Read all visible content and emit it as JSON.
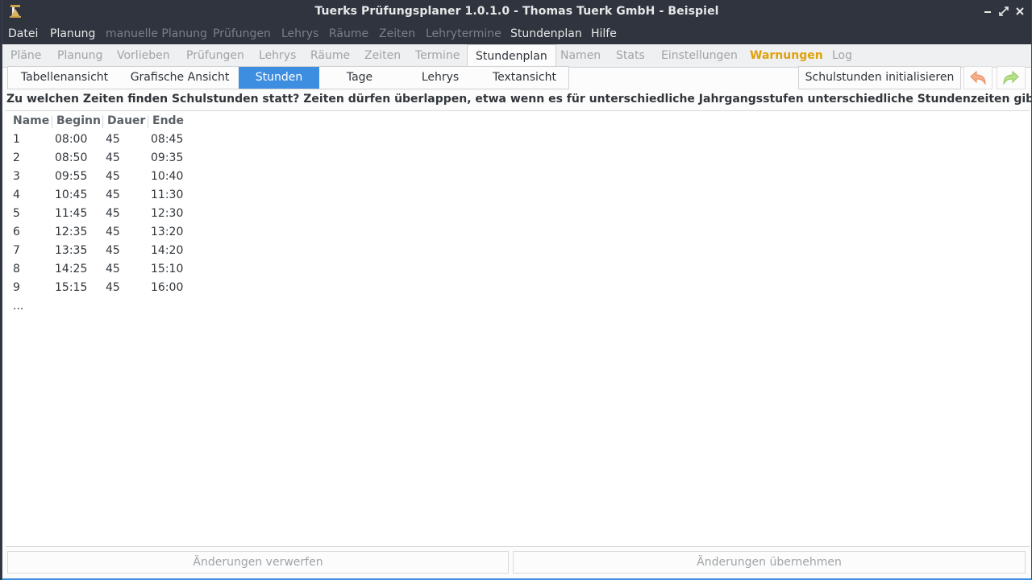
{
  "window": {
    "title": "Tuerks Prüfungsplaner 1.0.1.0 - Thomas Tuerk GmbH - Beispiel"
  },
  "menubar": {
    "items": [
      {
        "label": "Datei",
        "enabled": true
      },
      {
        "label": "Planung",
        "enabled": true
      },
      {
        "label": "manuelle Planung",
        "enabled": false
      },
      {
        "label": "Prüfungen",
        "enabled": false
      },
      {
        "label": "Lehrys",
        "enabled": false
      },
      {
        "label": "Räume",
        "enabled": false
      },
      {
        "label": "Zeiten",
        "enabled": false
      },
      {
        "label": "Lehrytermine",
        "enabled": false
      },
      {
        "label": "Stundenplan",
        "enabled": true
      },
      {
        "label": "Hilfe",
        "enabled": true
      }
    ]
  },
  "tabs": {
    "items": [
      {
        "label": "Pläne"
      },
      {
        "label": "Planung"
      },
      {
        "label": "Vorlieben"
      },
      {
        "label": "Prüfungen"
      },
      {
        "label": "Lehrys"
      },
      {
        "label": "Räume"
      },
      {
        "label": "Zeiten"
      },
      {
        "label": "Termine"
      },
      {
        "label": "Stundenplan",
        "active": true
      },
      {
        "label": "Namen"
      },
      {
        "label": "Stats"
      },
      {
        "label": "Einstellungen"
      },
      {
        "label": "Warnungen",
        "warning": true
      },
      {
        "label": "Log"
      }
    ]
  },
  "subtabs": {
    "items": [
      {
        "label": "Tabellenansicht"
      },
      {
        "label": "Grafische Ansicht"
      },
      {
        "label": "Stunden",
        "active": true
      },
      {
        "label": "Tage"
      },
      {
        "label": "Lehrys"
      },
      {
        "label": "Textansicht"
      }
    ]
  },
  "toolbar": {
    "init_label": "Schulstunden initialisieren",
    "undo_icon": "undo-arrow-icon",
    "redo_icon": "redo-arrow-icon",
    "undo_color": "#f0a078",
    "redo_color": "#a8d878"
  },
  "question": "Zu welchen Zeiten finden Schulstunden statt? Zeiten dürfen überlappen, etwa wenn es für unterschiedliche Jahrgangsstufen unterschiedliche Stundenzeiten gibt.",
  "table": {
    "columns": [
      "Name",
      "Beginn",
      "Dauer",
      "Ende"
    ],
    "rows": [
      [
        "1",
        "08:00",
        "45",
        "08:45"
      ],
      [
        "2",
        "08:50",
        "45",
        "09:35"
      ],
      [
        "3",
        "09:55",
        "45",
        "10:40"
      ],
      [
        "4",
        "10:45",
        "45",
        "11:30"
      ],
      [
        "5",
        "11:45",
        "45",
        "12:30"
      ],
      [
        "6",
        "12:35",
        "45",
        "13:20"
      ],
      [
        "7",
        "13:35",
        "45",
        "14:20"
      ],
      [
        "8",
        "14:25",
        "45",
        "15:10"
      ],
      [
        "9",
        "15:15",
        "45",
        "16:00"
      ]
    ],
    "more": "..."
  },
  "footer": {
    "discard_label": "Änderungen verwerfen",
    "apply_label": "Änderungen übernehmen"
  },
  "colors": {
    "accent": "#3d8ee0",
    "warning": "#e0a10a",
    "titlebar": "#2f343f"
  }
}
